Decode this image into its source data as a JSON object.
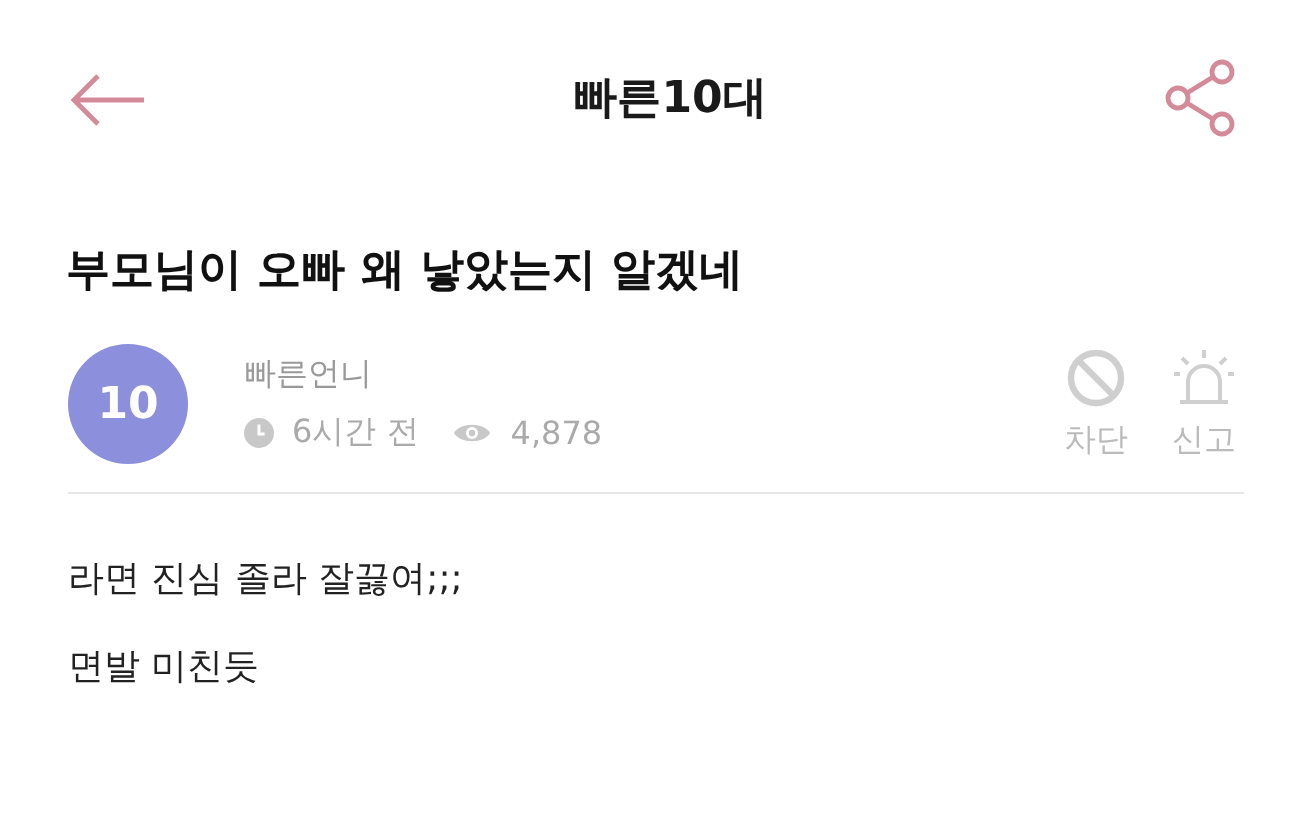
{
  "header": {
    "title": "빠른10대"
  },
  "post": {
    "title": "부모님이 오빠 왜 낳았는지 알겠네",
    "author": {
      "badge": "10",
      "name": "빠른언니",
      "time": "6시간 전",
      "views": "4,878"
    },
    "actions": [
      {
        "kind": "block",
        "label": "차단"
      },
      {
        "kind": "report",
        "label": "신고"
      }
    ],
    "body": [
      "라면 진심 졸라 잘끓여;;;",
      "면발 미친듯"
    ]
  }
}
